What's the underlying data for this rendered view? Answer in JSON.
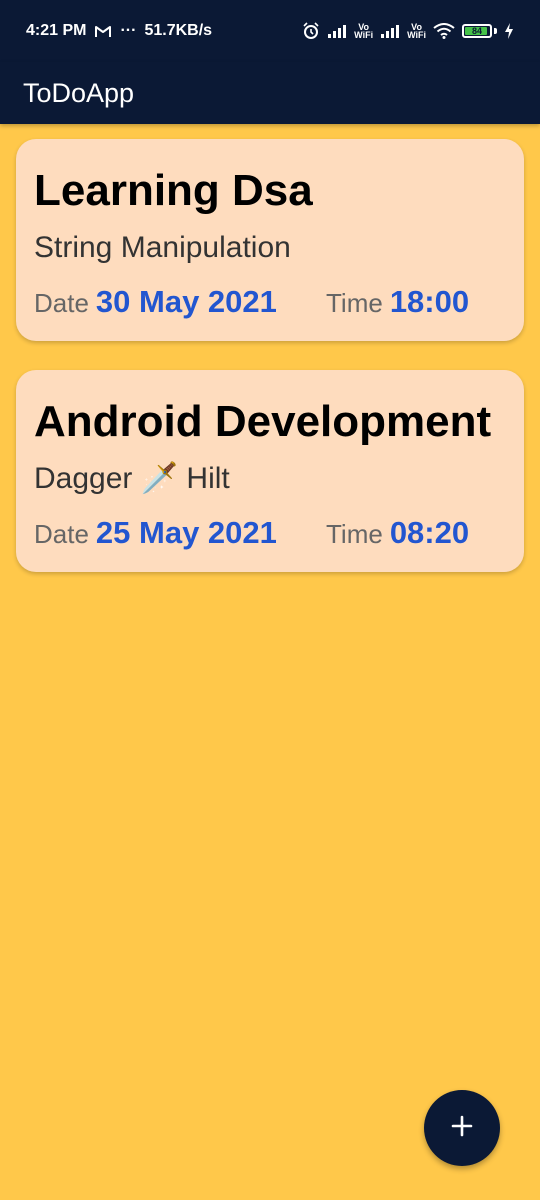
{
  "status_bar": {
    "time": "4:21 PM",
    "network_speed": "51.7KB/s",
    "ellipsis": "···",
    "vo_wifi_label_1": "Vo\nWiFi",
    "battery_level": "84",
    "icons": [
      "gmail-icon",
      "alarm-icon",
      "signal-icon",
      "signal-icon",
      "wifi-icon",
      "battery-icon",
      "charging-icon"
    ]
  },
  "app_bar": {
    "title": "ToDoApp"
  },
  "tasks": [
    {
      "title": "Learning Dsa",
      "description": "String Manipulation",
      "date_label": "Date",
      "date": "30 May 2021",
      "time_label": "Time",
      "time": "18:00"
    },
    {
      "title": "Android Development",
      "description": "Dagger 🗡️ Hilt",
      "date_label": "Date",
      "date": "25 May 2021",
      "time_label": "Time",
      "time": "08:20"
    }
  ],
  "fab": {
    "icon": "plus-icon"
  },
  "colors": {
    "background": "#FFC84A",
    "app_bar": "#0B1935",
    "card": "#FEDCBE",
    "accent": "#2256D0",
    "battery": "#46C249"
  }
}
